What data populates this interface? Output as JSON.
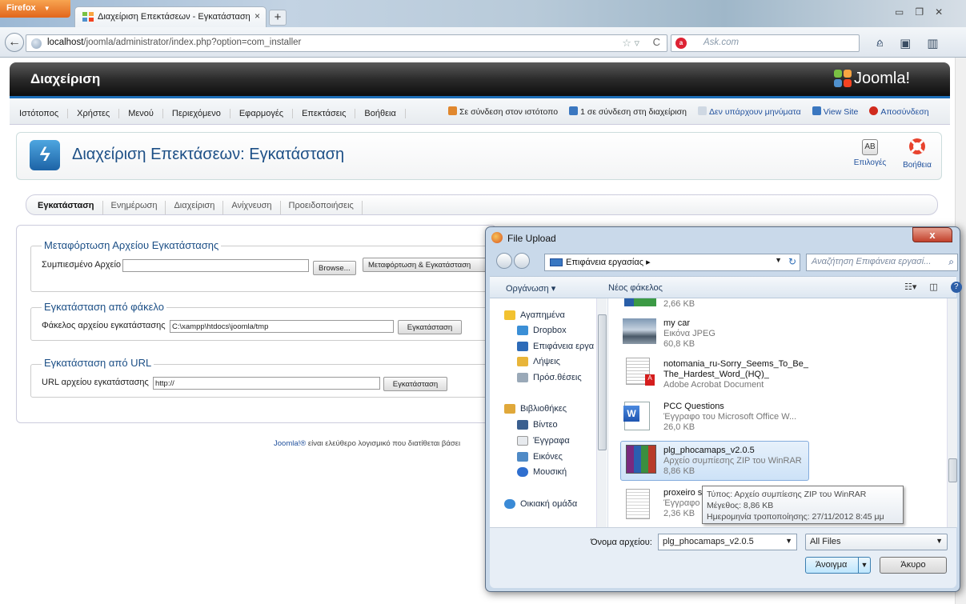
{
  "browser": {
    "menu_button": "Firefox",
    "tab_title": "Διαχείριση Επεκτάσεων - Εγκατάσταση",
    "new_tab": "+",
    "url_host": "localhost",
    "url_path": "/joomla/administrator/index.php?option=com_installer",
    "search_placeholder": "Ask.com"
  },
  "joomla": {
    "header_title": "Διαχείριση",
    "logo_text": "Joomla!",
    "menu": [
      "Ιστότοπος",
      "Χρήστες",
      "Μενού",
      "Περιεχόμενο",
      "Εφαρμογές",
      "Επεκτάσεις",
      "Βοήθεια"
    ],
    "status": {
      "site_users": "Σε σύνδεση στον ιστότοπο",
      "admin_users": "1 σε σύνδεση στη διαχείριση",
      "messages": "Δεν υπάρχουν μηνύματα",
      "view_site": "View Site",
      "logout": "Αποσύνδεση"
    },
    "page_title": "Διαχείριση Επεκτάσεων: Εγκατάσταση",
    "toolbar": {
      "options": "Επιλογές",
      "options_icon_text": "AB",
      "help": "Βοήθεια"
    },
    "subnav": [
      "Εγκατάσταση",
      "Ενημέρωση",
      "Διαχείριση",
      "Ανίχνευση",
      "Προειδοποιήσεις"
    ],
    "upload": {
      "legend": "Μεταφόρτωση Αρχείου Εγκατάστασης",
      "label": "Συμπιεσμένο Αρχείο",
      "browse": "Browse...",
      "submit": "Μεταφόρτωση & Εγκατάσταση"
    },
    "folder": {
      "legend": "Εγκατάσταση από φάκελο",
      "label": "Φάκελος αρχείου εγκατάστασης",
      "value": "C:\\xampp\\htdocs\\joomla/tmp",
      "submit": "Εγκατάσταση"
    },
    "url": {
      "legend": "Εγκατάσταση από URL",
      "label": "URL αρχείου εγκατάστασης",
      "value": "http://",
      "submit": "Εγκατάσταση"
    },
    "footer_link": "Joomla!®",
    "footer_text": " είναι ελεύθερο λογισμικό που διατίθεται βάσει"
  },
  "dialog": {
    "title": "File Upload",
    "close": "x",
    "path": "Επιφάνεια εργασίας",
    "path_sep": "▸",
    "search_placeholder": "Αναζήτηση Επιφάνεια εργασί...",
    "organize": "Οργάνωση ▾",
    "new_folder": "Νέος φάκελος",
    "nav": {
      "favorites": "Αγαπημένα",
      "dropbox": "Dropbox",
      "desktop": "Επιφάνεια εργα",
      "downloads": "Λήψεις",
      "recent": "Πρόσ.θέσεις",
      "libraries": "Βιβλιοθήκες",
      "videos": "Βίντεο",
      "documents": "Έγγραφα",
      "pictures": "Εικόνες",
      "music": "Μουσική",
      "homegroup": "Οικιακή ομάδα"
    },
    "files": [
      {
        "name": "",
        "type": "",
        "size": "2,66 KB"
      },
      {
        "name": "my car",
        "type": "Εικόνα JPEG",
        "size": "60,8 KB"
      },
      {
        "name": "notomania_ru-Sorry_Seems_To_Be_",
        "name2": "The_Hardest_Word_(HQ)_",
        "type": "Adobe Acrobat Document",
        "size": ""
      },
      {
        "name": "PCC Questions",
        "type": "Έγγραφο του Microsoft Office W...",
        "size": "26,0 KB"
      },
      {
        "name": "plg_phocamaps_v2.0.5",
        "type": "Αρχείο συμπίεσης ZIP του WinRAR",
        "size": "8,86 KB"
      },
      {
        "name": "proxeiro s",
        "type": "Έγγραφο",
        "size": "2,36 KB"
      }
    ],
    "tooltip": {
      "type": "Τύπος: Αρχείο συμπίεσης ZIP του WinRAR",
      "size": "Μέγεθος: 8,86 KB",
      "modified": "Ημερομηνία τροποποίησης: 27/11/2012 8:45 μμ"
    },
    "filename_label": "Όνομα αρχείου:",
    "filename_value": "plg_phocamaps_v2.0.5",
    "filter": "All Files",
    "open": "Άνοιγμα",
    "cancel": "Άκυρο"
  }
}
